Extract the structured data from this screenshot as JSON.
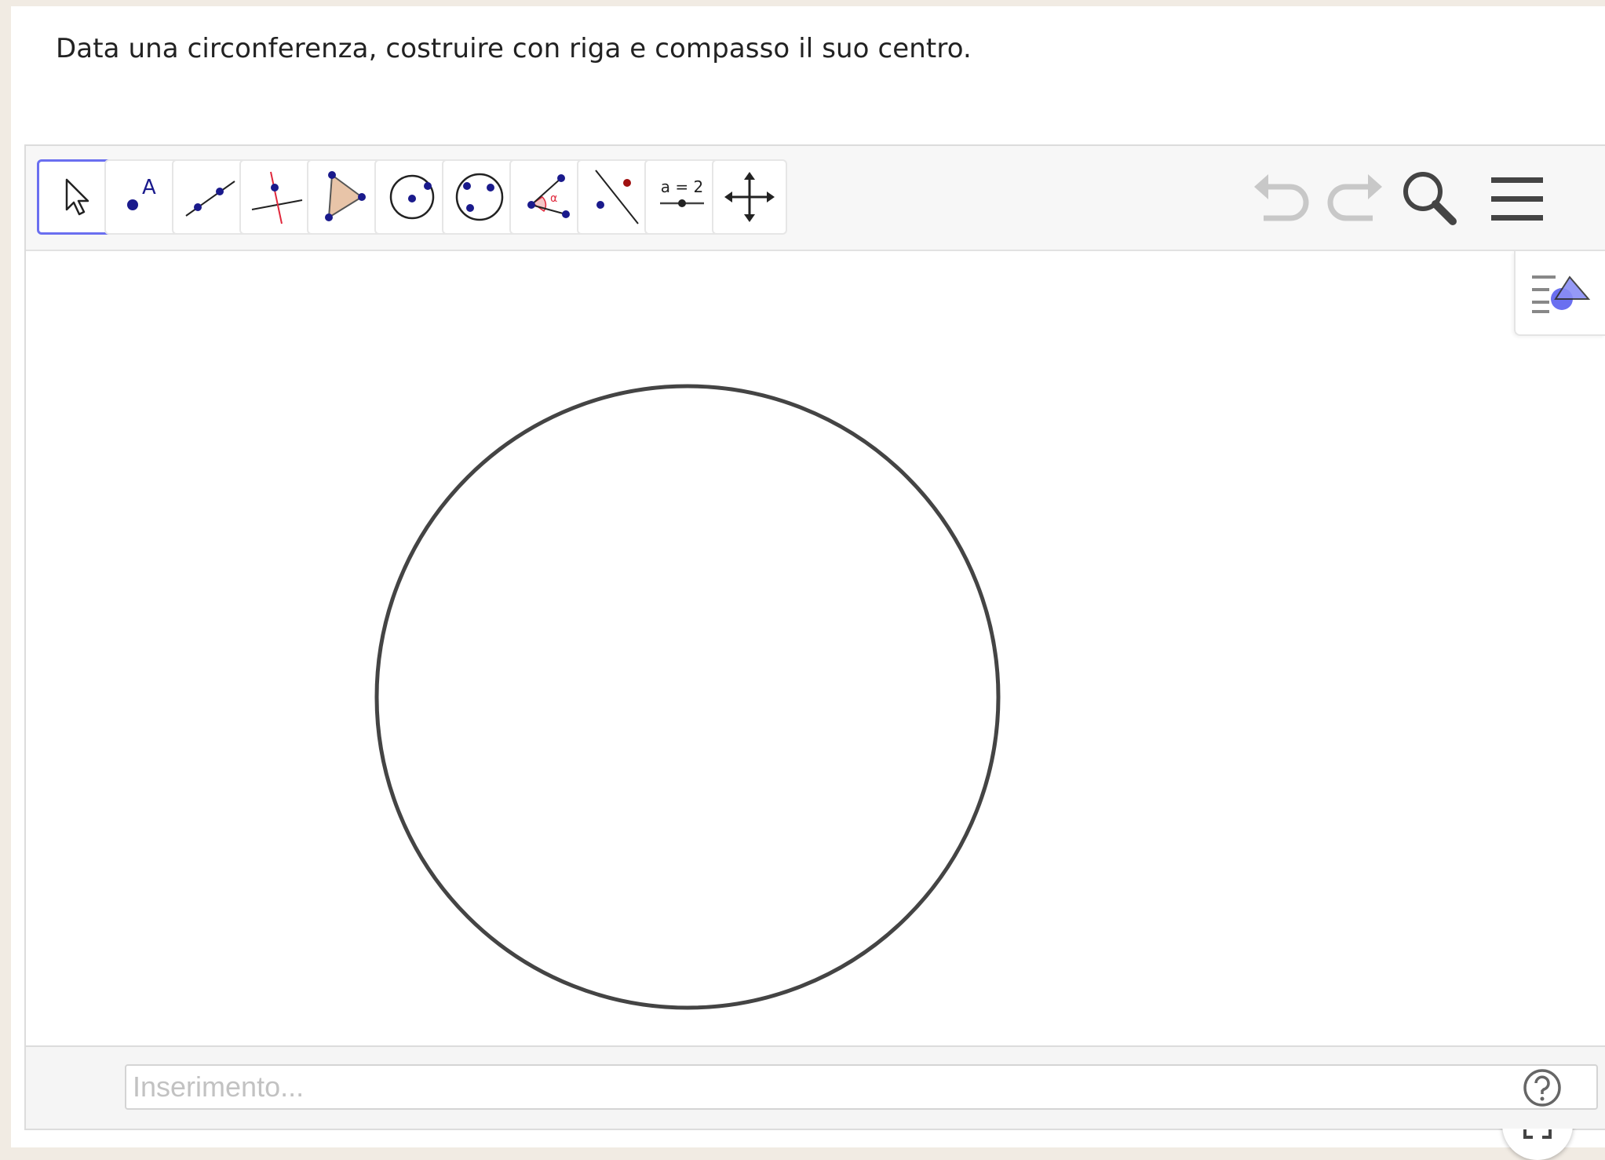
{
  "prompt": {
    "text": "Data una circonferenza, costruire con riga e compasso il suo centro."
  },
  "toolbar": {
    "tools": [
      {
        "icon": "move-arrow-icon",
        "selected": true
      },
      {
        "icon": "point-icon",
        "label": "A"
      },
      {
        "icon": "line-icon"
      },
      {
        "icon": "perpendicular-line-icon"
      },
      {
        "icon": "polygon-icon"
      },
      {
        "icon": "circle-center-point-icon"
      },
      {
        "icon": "circle-three-points-icon"
      },
      {
        "icon": "angle-icon",
        "label": "α"
      },
      {
        "icon": "reflect-about-line-icon"
      },
      {
        "icon": "slider-icon",
        "label": "a = 2"
      },
      {
        "icon": "move-graphics-view-icon"
      }
    ],
    "right_buttons": [
      "undo-icon",
      "redo-icon",
      "search-icon",
      "menu-icon"
    ]
  },
  "graphics": {
    "objects": [
      {
        "type": "circle",
        "color": "#444444"
      }
    ],
    "style_toggle_icon": "style-bar-toggle-icon",
    "fullscreen_icon": "fullscreen-icon"
  },
  "input_bar": {
    "placeholder": "Inserimento...",
    "value": "",
    "help_icon": "help-icon"
  },
  "colors": {
    "accent": "#6a6ff0",
    "point": "#1a1a8c",
    "perpendicular": "#e0283c",
    "polygon_fill": "#e8c4a8",
    "angle_mark": "#e0283c"
  }
}
